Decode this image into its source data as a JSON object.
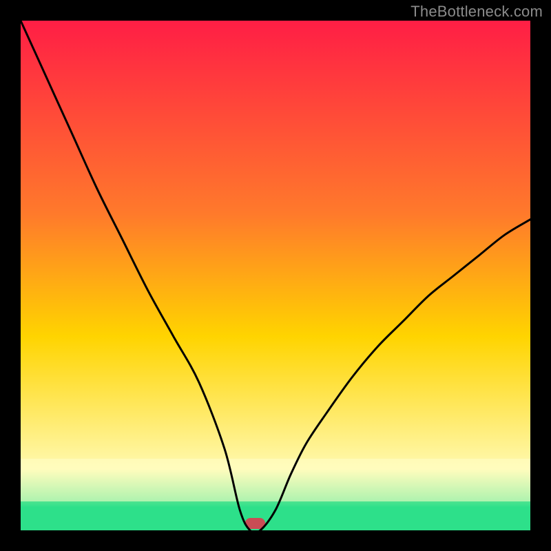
{
  "watermark": "TheBottleneck.com",
  "chart_data": {
    "type": "line",
    "title": "",
    "xlabel": "",
    "ylabel": "",
    "xlim": [
      0,
      100
    ],
    "ylim": [
      0,
      100
    ],
    "background_gradient": {
      "top": "#ff1e45",
      "mid_upper": "#ff7a2b",
      "mid": "#ffd400",
      "mid_lower": "#fff9b0",
      "green_band": "#2de08a",
      "bottom_tint": "#00e676"
    },
    "series": [
      {
        "name": "bottleneck-curve",
        "x": [
          0,
          5,
          10,
          15,
          20,
          25,
          30,
          35,
          40,
          43,
          45,
          47,
          50,
          53,
          56,
          60,
          65,
          70,
          75,
          80,
          85,
          90,
          95,
          100
        ],
        "y": [
          100,
          89,
          78,
          67,
          57,
          47,
          38,
          29,
          16,
          4,
          0,
          0,
          4,
          11,
          17,
          23,
          30,
          36,
          41,
          46,
          50,
          54,
          58,
          61
        ]
      }
    ],
    "trough_marker": {
      "x_center": 46,
      "y": 0,
      "width_pct": 4,
      "color": "#c94d55"
    }
  }
}
